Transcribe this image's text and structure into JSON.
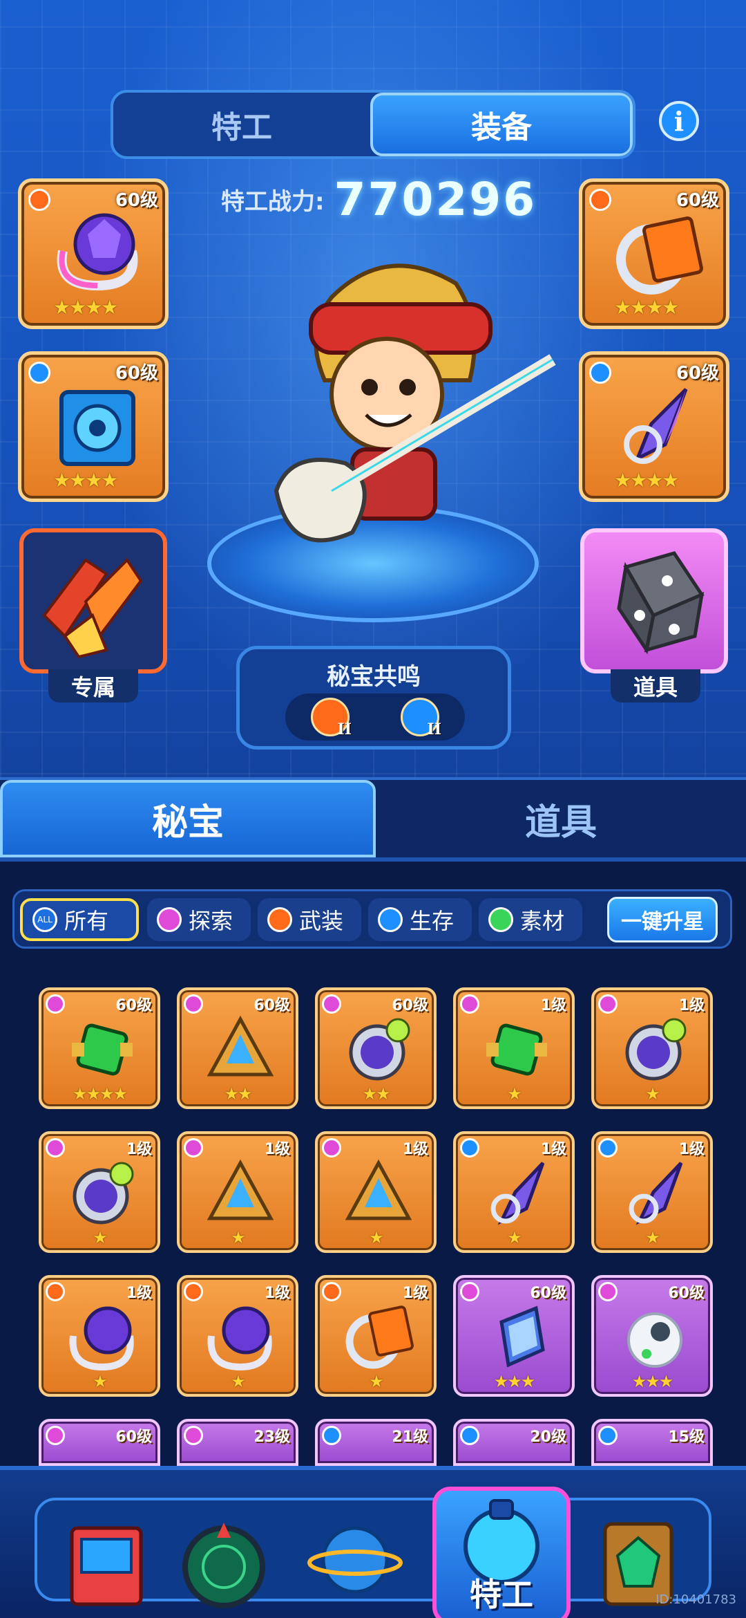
{
  "tabs": {
    "agent": "特工",
    "equipment": "装备"
  },
  "info_icon": "i",
  "power": {
    "label": "特工战力:",
    "value": "770296"
  },
  "slots": {
    "left": [
      {
        "level": "60级",
        "stars": "★★★★",
        "badge_color": "#ff6a1a",
        "icon": "crystal-bracelet"
      },
      {
        "level": "60级",
        "stars": "★★★★",
        "badge_color": "#1e8fff",
        "icon": "speaker-box"
      }
    ],
    "right": [
      {
        "level": "60级",
        "stars": "★★★★",
        "badge_color": "#ff6a1a",
        "icon": "blueprint-ring"
      },
      {
        "level": "60级",
        "stars": "★★★★",
        "badge_color": "#1e8fff",
        "icon": "crystal-shard"
      }
    ],
    "special_caption": "专属",
    "prop_caption": "道具"
  },
  "resonance": {
    "title": "秘宝共鸣",
    "badges": [
      "II",
      "II"
    ]
  },
  "section_tabs": {
    "treasure": "秘宝",
    "props": "道具"
  },
  "filters": [
    {
      "label": "所有",
      "dot": "ALL",
      "color": "#1e6fe0",
      "active": true
    },
    {
      "label": "探索",
      "color": "#e04ad8"
    },
    {
      "label": "武装",
      "color": "#ff6a1a"
    },
    {
      "label": "生存",
      "color": "#1e8fff"
    },
    {
      "label": "素材",
      "color": "#3bd45a"
    }
  ],
  "upgrade_all": "一键升星",
  "items": [
    {
      "level": "60级",
      "stars": "★★★★",
      "badge": "#e04ad8",
      "purple": false,
      "icon": "green-gem"
    },
    {
      "level": "60级",
      "stars": "★★",
      "badge": "#e04ad8",
      "purple": false,
      "icon": "pyramid"
    },
    {
      "level": "60级",
      "stars": "★★",
      "badge": "#e04ad8",
      "purple": false,
      "icon": "pocket-watch"
    },
    {
      "level": "1级",
      "stars": "★",
      "badge": "#e04ad8",
      "purple": false,
      "icon": "green-gem"
    },
    {
      "level": "1级",
      "stars": "★",
      "badge": "#e04ad8",
      "purple": false,
      "icon": "pocket-watch"
    },
    {
      "level": "1级",
      "stars": "★",
      "badge": "#e04ad8",
      "purple": false,
      "icon": "pocket-watch"
    },
    {
      "level": "1级",
      "stars": "★",
      "badge": "#e04ad8",
      "purple": false,
      "icon": "pyramid"
    },
    {
      "level": "1级",
      "stars": "★",
      "badge": "#e04ad8",
      "purple": false,
      "icon": "pyramid"
    },
    {
      "level": "1级",
      "stars": "★",
      "badge": "#1e8fff",
      "purple": false,
      "icon": "crystal-shard"
    },
    {
      "level": "1级",
      "stars": "★",
      "badge": "#1e8fff",
      "purple": false,
      "icon": "crystal-shard"
    },
    {
      "level": "1级",
      "stars": "★",
      "badge": "#ff6a1a",
      "purple": false,
      "icon": "crystal-bracelet"
    },
    {
      "level": "1级",
      "stars": "★",
      "badge": "#ff6a1a",
      "purple": false,
      "icon": "crystal-bracelet"
    },
    {
      "level": "1级",
      "stars": "★",
      "badge": "#ff6a1a",
      "purple": false,
      "icon": "blueprint-ring"
    },
    {
      "level": "60级",
      "stars": "★★★",
      "badge": "#e04ad8",
      "purple": true,
      "icon": "crystal-block"
    },
    {
      "level": "60级",
      "stars": "★★★",
      "badge": "#e04ad8",
      "purple": true,
      "icon": "fur-ring"
    },
    {
      "level": "60级",
      "stars": "",
      "badge": "#e04ad8",
      "purple": true,
      "icon": "device"
    },
    {
      "level": "23级",
      "stars": "",
      "badge": "#e04ad8",
      "purple": true,
      "icon": "device"
    },
    {
      "level": "21级",
      "stars": "",
      "badge": "#1e8fff",
      "purple": true,
      "icon": "device"
    },
    {
      "level": "20级",
      "stars": "",
      "badge": "#1e8fff",
      "purple": true,
      "icon": "device"
    },
    {
      "level": "15级",
      "stars": "",
      "badge": "#1e8fff",
      "purple": true,
      "icon": "device"
    }
  ],
  "nav": {
    "active_label": "特工"
  },
  "watermark": "ID:10401783"
}
